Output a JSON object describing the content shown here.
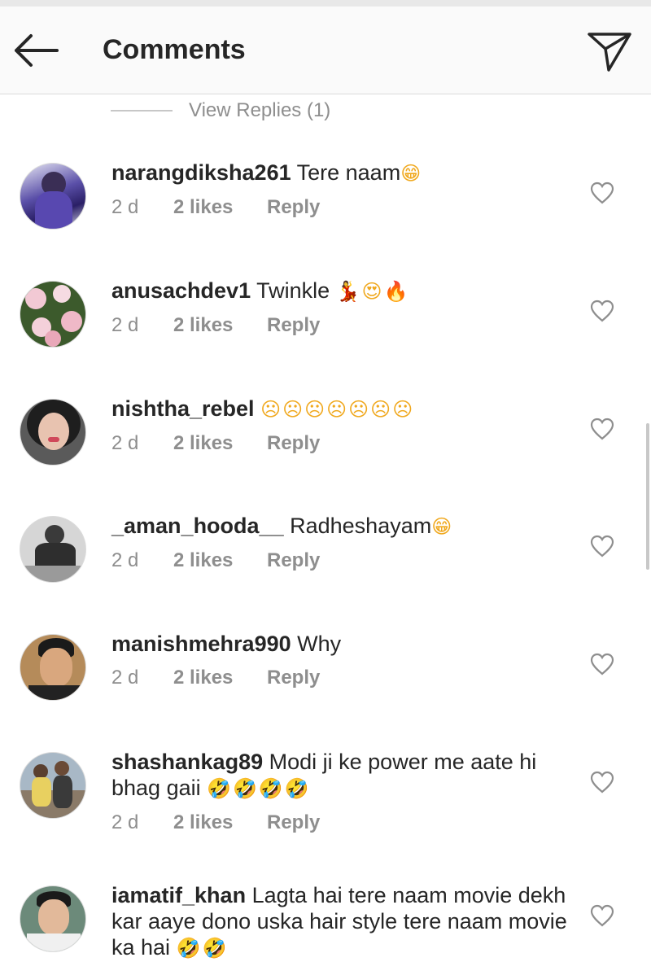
{
  "header": {
    "title": "Comments",
    "back_icon": "arrow-left-icon",
    "send_icon": "paper-plane-icon"
  },
  "view_replies": "View Replies (1)",
  "comments": [
    {
      "username": "narangdiksha261",
      "text": "Tere naam",
      "emoji": "😁",
      "time": "2 d",
      "likes": "2 likes",
      "reply": "Reply"
    },
    {
      "username": "anusachdev1",
      "text": "Twinkle",
      "emoji": "💃😍🔥",
      "time": "2 d",
      "likes": "2 likes",
      "reply": "Reply"
    },
    {
      "username": "nishtha_rebel",
      "text": "",
      "emoji": "☹☹☹☹☹☹☹",
      "time": "2 d",
      "likes": "2 likes",
      "reply": "Reply"
    },
    {
      "username": "_aman_hooda__",
      "text": "Radheshayam",
      "emoji": "😁",
      "time": "2 d",
      "likes": "2 likes",
      "reply": "Reply"
    },
    {
      "username": "manishmehra990",
      "text": "Why",
      "emoji": "",
      "time": "2 d",
      "likes": "2 likes",
      "reply": "Reply"
    },
    {
      "username": "shashankag89",
      "text": "Modi ji ke power me aate hi bhag gaii",
      "emoji": "🤣🤣🤣🤣",
      "time": "2 d",
      "likes": "2 likes",
      "reply": "Reply"
    },
    {
      "username": "iamatif_khan",
      "text": "Lagta hai tere naam movie dekh kar aaye dono uska hair style tere naam movie ka hai",
      "emoji": "🤣🤣",
      "time": "",
      "likes": "",
      "reply": ""
    }
  ],
  "colors": {
    "text": "#262626",
    "secondary": "#8e8e8e",
    "emoji": "#f0a81d",
    "header_bg": "#fafafa"
  }
}
